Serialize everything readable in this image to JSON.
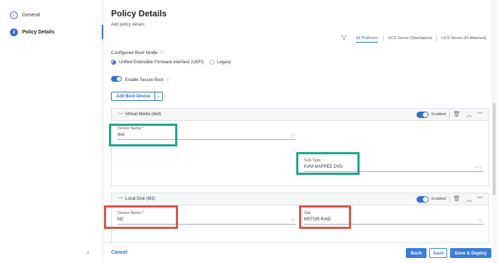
{
  "wizard": {
    "steps": [
      {
        "label": "General",
        "number": "✓"
      },
      {
        "label": "Policy Details",
        "number": "2"
      }
    ]
  },
  "page": {
    "title": "Policy Details",
    "subtitle": "Add policy details"
  },
  "platform_tabs": [
    "All Platforms",
    "UCS Server (Standalone)",
    "UCS Server (FI-Attached)"
  ],
  "boot_mode": {
    "label": "Configured Boot Mode",
    "options": [
      "Unified Extensible Firmware Interface (UEFI)",
      "Legacy"
    ],
    "selected": "Unified Extensible Firmware Interface (UEFI)"
  },
  "secure_boot": {
    "label": "Enable Secure Boot",
    "on": true
  },
  "add_boot_device": {
    "label": "Add Boot Device"
  },
  "devices": [
    {
      "title": "Virtual Media (dvd)",
      "enabled_label": "Enabled",
      "device_name_label": "Device Name *",
      "device_name": "dvd",
      "subtype_label": "Sub-Type",
      "subtype": "KVM MAPPED DVD"
    },
    {
      "title": "Local Disk (M2)",
      "enabled_label": "Enabled",
      "device_name_label": "Device Name *",
      "device_name": "M2",
      "slot_label": "Slot",
      "slot": "MSTOR-RAID"
    }
  ],
  "footer": {
    "cancel": "Cancel",
    "back": "Back",
    "save": "Save",
    "save_deploy": "Save & Deploy"
  },
  "colors": {
    "accent": "#2f6fc7",
    "highlight_green": "#1fa38f",
    "highlight_red": "#d3564a"
  }
}
